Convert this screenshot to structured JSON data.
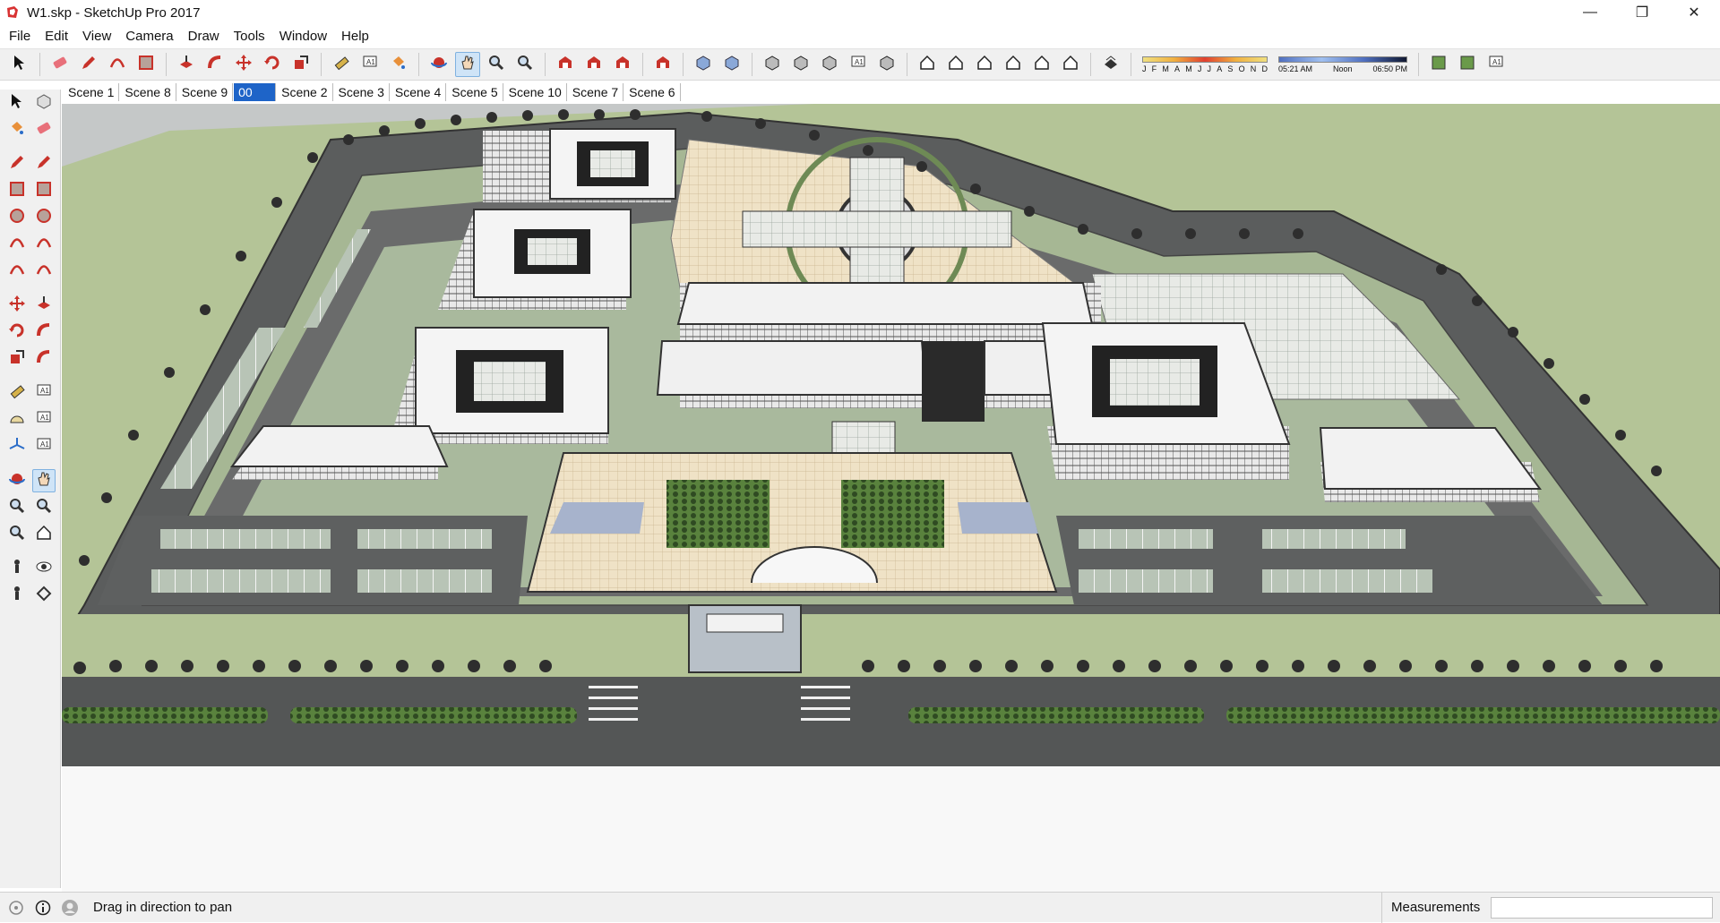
{
  "window": {
    "title": "W1.skp - SketchUp Pro 2017",
    "minimize_glyph": "—",
    "restore_glyph": "❐",
    "close_glyph": "✕"
  },
  "menu": [
    "File",
    "Edit",
    "View",
    "Camera",
    "Draw",
    "Tools",
    "Window",
    "Help"
  ],
  "toolbar": {
    "groups": [
      [
        "select-icon"
      ],
      [
        "eraser-icon",
        "pencil-icon",
        "arc-icon",
        "rectangle-icon"
      ],
      [
        "push-pull-icon",
        "follow-me-icon",
        "move-icon",
        "rotate-icon",
        "scale-icon"
      ],
      [
        "tape-measure-icon",
        "text-icon",
        "paint-bucket-icon"
      ],
      [
        "orbit-icon",
        "pan-icon",
        "zoom-icon",
        "zoom-extents-icon"
      ],
      [
        "warehouse-icon",
        "extension-warehouse-icon",
        "send-to-layout-icon"
      ],
      [
        "ruby-console-icon"
      ],
      [
        "xray-icon",
        "back-edges-icon"
      ],
      [
        "wireframe-icon",
        "hidden-line-icon",
        "shaded-icon",
        "shaded-textures-icon",
        "monochrome-icon"
      ],
      [
        "iso-view-icon",
        "top-view-icon",
        "front-view-icon",
        "right-view-icon",
        "back-view-icon",
        "left-view-icon"
      ],
      [
        "shadow-toggle-icon"
      ]
    ],
    "shadow": {
      "months": [
        "J",
        "F",
        "M",
        "A",
        "M",
        "J",
        "J",
        "A",
        "S",
        "O",
        "N",
        "D"
      ],
      "time_start": "05:21 AM",
      "time_mid": "Noon",
      "time_end": "06:50 PM"
    },
    "extra": [
      "geo-location-icon",
      "add-location-icon",
      "photo-textures-icon"
    ]
  },
  "scenes": [
    "Scene 1",
    "Scene 8",
    "Scene 9",
    "00",
    "Scene 2",
    "Scene 3",
    "Scene 4",
    "Scene 5",
    "Scene 10",
    "Scene 7",
    "Scene 6"
  ],
  "scene_editing_index": 3,
  "left_tools": [
    [
      "select-icon",
      "make-component-icon"
    ],
    [
      "paint-bucket-icon",
      "eraser-icon"
    ],
    [
      "pencil-icon",
      "freehand-icon"
    ],
    [
      "rectangle-icon",
      "rotated-rectangle-icon"
    ],
    [
      "circle-icon",
      "polygon-icon"
    ],
    [
      "arc-icon",
      "two-point-arc-icon"
    ],
    [
      "three-point-arc-icon",
      "pie-icon"
    ],
    [
      "move-icon",
      "push-pull-icon"
    ],
    [
      "rotate-icon",
      "follow-me-icon"
    ],
    [
      "scale-icon",
      "offset-icon"
    ],
    [
      "tape-measure-icon",
      "dimension-icon"
    ],
    [
      "protractor-icon",
      "text-icon"
    ],
    [
      "axes-icon",
      "3d-text-icon"
    ],
    [
      "orbit-icon",
      "pan-icon"
    ],
    [
      "zoom-icon",
      "zoom-window-icon"
    ],
    [
      "zoom-extents-icon",
      "previous-view-icon"
    ],
    [
      "position-camera-icon",
      "look-around-icon"
    ],
    [
      "walk-icon",
      "section-plane-icon"
    ]
  ],
  "status": {
    "message": "Drag in direction to pan",
    "measurements_label": "Measurements",
    "measurements_value": ""
  }
}
